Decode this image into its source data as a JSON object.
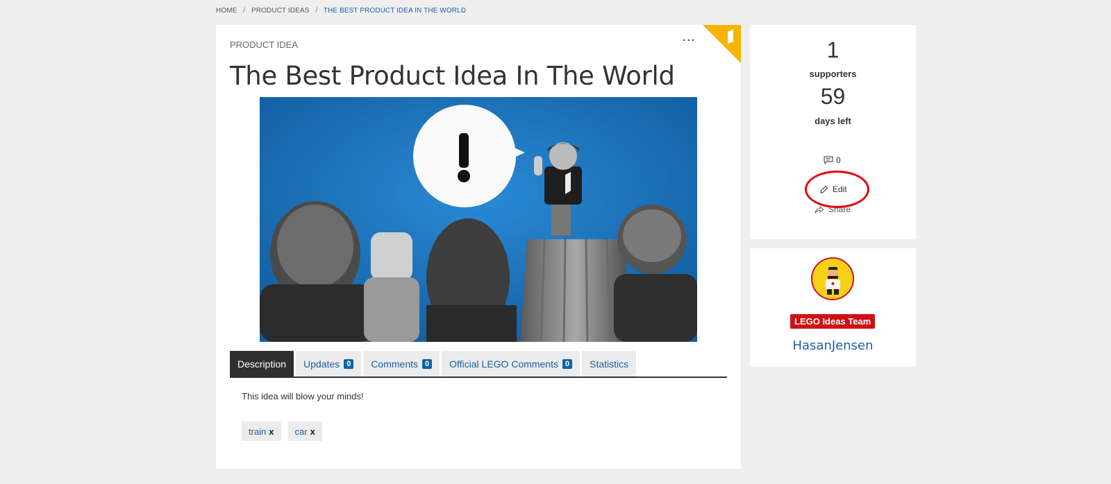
{
  "breadcrumb": {
    "home": "HOME",
    "product_ideas": "PRODUCT IDEAS",
    "current": "THE BEST PRODUCT IDEA IN THE WORLD"
  },
  "idea": {
    "kicker": "PRODUCT IDEA",
    "more_label": "···",
    "title": "The Best Product Idea In The World",
    "hero_icon": "exclamation-speech-bubble",
    "description": "This idea will blow your minds!"
  },
  "tabs": [
    {
      "label": "Description",
      "active": true
    },
    {
      "label": "Updates",
      "count": "0"
    },
    {
      "label": "Comments",
      "count": "0"
    },
    {
      "label": "Official LEGO Comments",
      "count": "0"
    },
    {
      "label": "Statistics"
    }
  ],
  "tags": [
    {
      "label": "train",
      "remove": "x"
    },
    {
      "label": "car",
      "remove": "x"
    }
  ],
  "stats": {
    "supporters_count": "1",
    "supporters_label": "supporters",
    "days_left_count": "59",
    "days_left_label": "days left",
    "comments_count": "0",
    "edit_label": "Edit",
    "share_label": "Share"
  },
  "user": {
    "team_badge": "LEGO Ideas Team",
    "username": "HasanJensen"
  },
  "colors": {
    "accent_blue": "#1a5fa8",
    "badge_blue": "#0c63a8",
    "corner_yellow": "#f7b500",
    "highlight_red": "#e60012",
    "team_red": "#d01012"
  }
}
